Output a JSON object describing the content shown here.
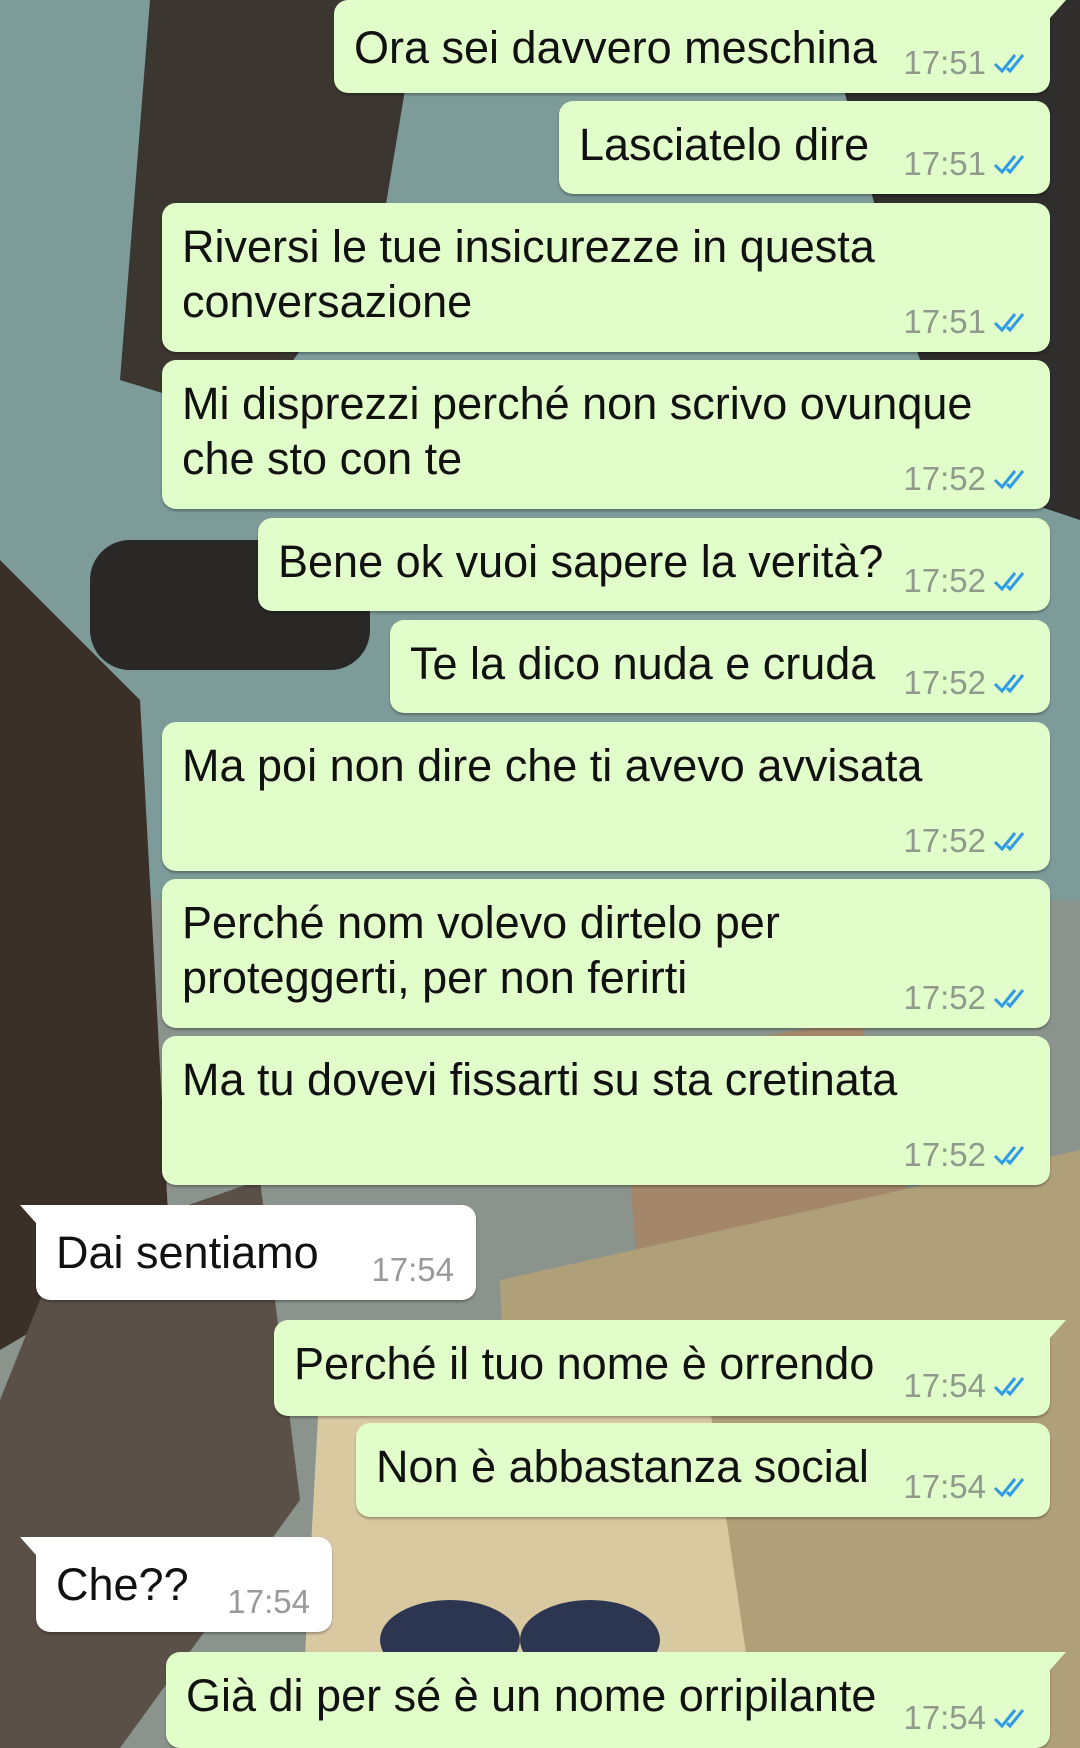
{
  "colors": {
    "outgoing_bubble": "#e1fdca",
    "incoming_bubble": "#ffffff",
    "read_ticks": "#2f9be8",
    "timestamp": "#8f9a8c"
  },
  "icons": {
    "read_status": "double-check-icon"
  },
  "messages": [
    {
      "dir": "out",
      "text": "Ora sei davvero meschina",
      "time": "17:51",
      "status": "read"
    },
    {
      "dir": "out",
      "text": "Lasciatelo dire",
      "time": "17:51",
      "status": "read"
    },
    {
      "dir": "out",
      "text": "Riversi le tue insicurezze in questa\nconversazione",
      "time": "17:51",
      "status": "read"
    },
    {
      "dir": "out",
      "text": "Mi disprezzi perché non scrivo ovunque\nche sto con te",
      "time": "17:52",
      "status": "read"
    },
    {
      "dir": "out",
      "text": "Bene ok vuoi sapere la verità?",
      "time": "17:52",
      "status": "read"
    },
    {
      "dir": "out",
      "text": "Te la dico nuda e cruda",
      "time": "17:52",
      "status": "read"
    },
    {
      "dir": "out",
      "text": "Ma poi non dire che ti avevo avvisata",
      "time": "17:52",
      "status": "read"
    },
    {
      "dir": "out",
      "text": "Perché nom volevo dirtelo per\nproteggerti, per non ferirti",
      "time": "17:52",
      "status": "read"
    },
    {
      "dir": "out",
      "text": "Ma tu dovevi fissarti su sta cretinata",
      "time": "17:52",
      "status": "read"
    },
    {
      "dir": "in",
      "text": "Dai sentiamo",
      "time": "17:54"
    },
    {
      "dir": "out",
      "text": "Perché il tuo nome è orrendo",
      "time": "17:54",
      "status": "read"
    },
    {
      "dir": "out",
      "text": "Non è abbastanza social",
      "time": "17:54",
      "status": "read"
    },
    {
      "dir": "in",
      "text": "Che??",
      "time": "17:54"
    },
    {
      "dir": "out",
      "text": "Già di per sé è un nome orripilante",
      "time": "17:54",
      "status": "read"
    }
  ]
}
